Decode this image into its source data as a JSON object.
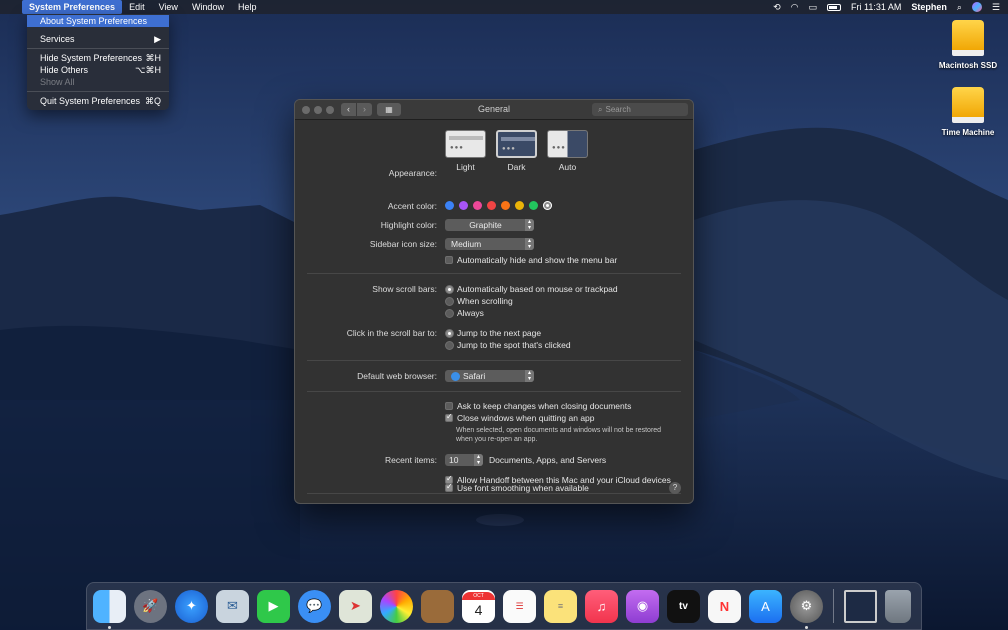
{
  "menubar": {
    "app_name": "System Preferences",
    "menus": [
      "Edit",
      "View",
      "Window",
      "Help"
    ],
    "clock": "Fri 11:31 AM",
    "user": "Stephen"
  },
  "app_menu": {
    "about": "About System Preferences",
    "services": "Services",
    "services_arrow": "▶",
    "hide": "Hide System Preferences",
    "hide_shortcut": "⌘H",
    "hide_others": "Hide Others",
    "hide_others_shortcut": "⌥⌘H",
    "show_all": "Show All",
    "quit": "Quit System Preferences",
    "quit_shortcut": "⌘Q"
  },
  "desktop_icons": [
    "Macintosh SSD",
    "Time Machine"
  ],
  "window": {
    "title": "General",
    "search_placeholder": "Search"
  },
  "general": {
    "appearance_label": "Appearance:",
    "appearance_options": [
      "Light",
      "Dark",
      "Auto"
    ],
    "appearance_selected": "Dark",
    "accent_label": "Accent color:",
    "accent_colors": [
      "#3b82f6",
      "#a855f7",
      "#ec4899",
      "#ef4444",
      "#f97316",
      "#eab308",
      "#22c55e",
      "#8e8e8e"
    ],
    "highlight_label": "Highlight color:",
    "highlight_value": "Graphite",
    "sidebar_label": "Sidebar icon size:",
    "sidebar_value": "Medium",
    "menu_bar_autohide": "Automatically hide and show the menu bar",
    "scroll_bars_label": "Show scroll bars:",
    "scroll_options": [
      "Automatically based on mouse or trackpad",
      "When scrolling",
      "Always"
    ],
    "click_scroll_label": "Click in the scroll bar to:",
    "click_options": [
      "Jump to the next page",
      "Jump to the spot that's clicked"
    ],
    "browser_label": "Default web browser:",
    "browser_value": "Safari",
    "ask_keep_changes": "Ask to keep changes when closing documents",
    "close_windows": "Close windows when quitting an app",
    "close_windows_note": "When selected, open documents and windows will not be restored when you re-open an app.",
    "recent_label": "Recent items:",
    "recent_value": "10",
    "recent_suffix": "Documents, Apps, and Servers",
    "handoff": "Allow Handoff between this Mac and your iCloud devices",
    "font_smoothing": "Use font smoothing when available",
    "help": "?"
  },
  "dock": {
    "calendar_month": "OCT",
    "calendar_day": "4",
    "tv_label": "tv"
  },
  "colors": {
    "menu_highlight": "#3e6fd1",
    "window_bg": "#323232"
  }
}
